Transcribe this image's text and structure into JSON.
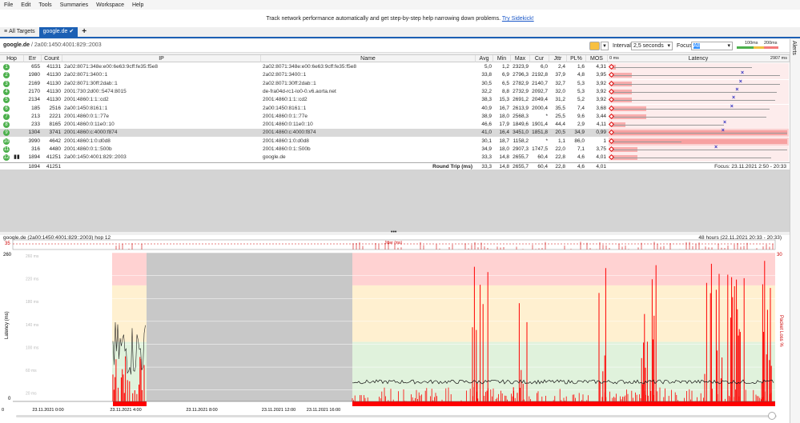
{
  "menu": [
    "File",
    "Edit",
    "Tools",
    "Summaries",
    "Workspace",
    "Help"
  ],
  "banner": {
    "text": "Track network performance automatically and get step-by-step help narrowing down problems.",
    "link": "Try Sidekick!"
  },
  "tabs": [
    {
      "label": "All Targets"
    },
    {
      "label": "google.de"
    }
  ],
  "toolbar": {
    "target": "google.de",
    "ip": "/ 2a00:1450:4001:829::2003",
    "interval_label": "Interval",
    "interval_value": "2,5 seconds",
    "focus_label": "Focus",
    "focus_value": "All",
    "scale_100": "100ms",
    "scale_200": "200ms"
  },
  "side_label": "Alerts",
  "columns": {
    "hop": "Hop",
    "err": "Err",
    "count": "Count",
    "ip": "IP",
    "name": "Name",
    "avg": "Avg",
    "min": "Min",
    "max": "Max",
    "cur": "Cur",
    "jttr": "Jttr",
    "pl": "PL%",
    "mos": "MOS",
    "latency": "Latency",
    "lat_min": "0 ms",
    "lat_max": "2907 ms"
  },
  "rows": [
    {
      "hop": "1",
      "err": "655",
      "count": "41131",
      "ip": "2a02:8071:348e:e00:6e63:9cff:fe35:f5e8",
      "name": "2a02:8071:348e:e00:6e63:9cff:fe35:f5e8",
      "avg": "5,0",
      "min": "1,2",
      "max": "2323,9",
      "cur": "6,0",
      "jttr": "2,4",
      "pl": "1,6",
      "mos": "4,31",
      "bar": 0.02,
      "range": 0.8,
      "cross": 0
    },
    {
      "hop": "2",
      "err": "1980",
      "count": "41130",
      "ip": "2a02:8071:3400::1",
      "name": "2a02:8071:3400::1",
      "avg": "33,8",
      "min": "6,9",
      "max": "2796,3",
      "cur": "2192,8",
      "jttr": "37,9",
      "pl": "4,8",
      "mos": "3,95",
      "bar": 0.12,
      "range": 0.96,
      "cross": 0.75
    },
    {
      "hop": "3",
      "err": "2169",
      "count": "41130",
      "ip": "2a02:8071:30ff:2dab::1",
      "name": "2a02:8071:30ff:2dab::1",
      "avg": "30,5",
      "min": "6,5",
      "max": "2782,9",
      "cur": "2140,7",
      "jttr": "32,7",
      "pl": "5,3",
      "mos": "3,92",
      "bar": 0.12,
      "range": 0.96,
      "cross": 0.74
    },
    {
      "hop": "4",
      "err": "2170",
      "count": "41130",
      "ip": "2001:730:2d00::5474:8015",
      "name": "de-fra04d-rc1-lo0-0.v6.aorta.net",
      "avg": "32,2",
      "min": "8,8",
      "max": "2732,9",
      "cur": "2092,7",
      "jttr": "32,0",
      "pl": "5,3",
      "mos": "3,92",
      "bar": 0.12,
      "range": 0.94,
      "cross": 0.72
    },
    {
      "hop": "5",
      "err": "2134",
      "count": "41130",
      "ip": "2001:4860:1:1::cd2",
      "name": "2001:4860:1:1::cd2",
      "avg": "38,3",
      "min": "15,3",
      "max": "2691,2",
      "cur": "2049,4",
      "jttr": "31,2",
      "pl": "5,2",
      "mos": "3,92",
      "bar": 0.12,
      "range": 0.93,
      "cross": 0.7
    },
    {
      "hop": "6",
      "err": "185",
      "count": "2516",
      "ip": "2a00:1450:8161::1",
      "name": "2a00:1450:8161::1",
      "avg": "40,9",
      "min": "16,7",
      "max": "2613,9",
      "cur": "2000,4",
      "jttr": "35,5",
      "pl": "7,4",
      "mos": "3,68",
      "bar": 0.2,
      "range": 0.9,
      "cross": 0.69
    },
    {
      "hop": "7",
      "err": "213",
      "count": "2221",
      "ip": "2001:4860:0:1::77e",
      "name": "2001:4860:0:1::77e",
      "avg": "38,9",
      "min": "18,0",
      "max": "2568,3",
      "cur": "*",
      "jttr": "25,5",
      "pl": "9,6",
      "mos": "3,44",
      "bar": 0.2,
      "range": 0.88,
      "cross": 0
    },
    {
      "hop": "8",
      "err": "233",
      "count": "8165",
      "ip": "2001:4860:0:11e0::10",
      "name": "2001:4860:0:11e0::10",
      "avg": "46,6",
      "min": "17,9",
      "max": "1849,6",
      "cur": "1901,4",
      "jttr": "44,4",
      "pl": "2,9",
      "mos": "4,11",
      "bar": 0.08,
      "range": 0.64,
      "cross": 0.65
    },
    {
      "hop": "9",
      "err": "1304",
      "count": "3741",
      "ip": "2001:4860:c:4000:f874",
      "name": "2001:4860:c:4000:f874",
      "avg": "41,0",
      "min": "16,4",
      "max": "3451,0",
      "cur": "1851,8",
      "jttr": "20,5",
      "pl": "34,9",
      "mos": "0,99",
      "bar": 1.0,
      "range": 1.0,
      "cross": 0.64
    },
    {
      "hop": "10",
      "err": "3990",
      "count": "4642",
      "ip": "2001:4860:1:0:d0d8",
      "name": "2001:4860:1:0:d0d8",
      "avg": "30,1",
      "min": "18,7",
      "max": "1158,2",
      "cur": "*",
      "jttr": "1,1",
      "pl": "86,0",
      "mos": "1",
      "bar": 1.0,
      "range": 0.4,
      "cross": 0
    },
    {
      "hop": "11",
      "err": "316",
      "count": "4480",
      "ip": "2001:4860:0:1::500b",
      "name": "2001:4860:0:1::500b",
      "avg": "34,9",
      "min": "18,0",
      "max": "2907,3",
      "cur": "1747,5",
      "jttr": "22,0",
      "pl": "7,1",
      "mos": "3,75",
      "bar": 0.15,
      "range": 1.0,
      "cross": 0.6
    },
    {
      "hop": "12",
      "err": "1894",
      "count": "41251",
      "ip": "2a00:1450:4001:829::2003",
      "name": "google.de",
      "avg": "33,3",
      "min": "14,8",
      "max": "2655,7",
      "cur": "60,4",
      "jttr": "22,8",
      "pl": "4,6",
      "mos": "4,01",
      "bar": 0.15,
      "range": 0.91,
      "cross": 0
    }
  ],
  "totals": {
    "err": "1894",
    "count": "41251",
    "label": "Round Trip (ms)",
    "avg": "33,3",
    "min": "14,8",
    "max": "2655,7",
    "cur": "60,4",
    "jttr": "22,8",
    "pl": "4,6",
    "mos": "4,01",
    "focus": "Focus: 23.11.2021 2:50 - 20:33"
  },
  "graph": {
    "title": "google.de (2a00:1450:4001:829::2003) hop 12",
    "range": "48 hours (22.11.2021 20:33 - 20:33)",
    "y_top": "260",
    "y_bottom": "0",
    "y_axis_label": "Latency (ms)",
    "right_top": "30",
    "right_label": "Packet Loss %",
    "jitter_label": "Jitter (ms)",
    "jitter_scale": "35",
    "x_zero": "0",
    "x_ticks": [
      "23.11.2021 0:00",
      "23.11.2021 4:00",
      "23.11.2021 8:00",
      "23.11.2021 12:00",
      "23.11.2021 16:00"
    ],
    "y_gridlines": [
      "260 ms",
      "220 ms",
      "180 ms",
      "140 ms",
      "100 ms",
      "60 ms",
      "20 ms"
    ]
  },
  "colors": {
    "accent": "#1c60b4",
    "hop_ok": "#4cb04c",
    "bar_red": "#f47a7a",
    "loss_red": "#ff0000",
    "zone_red": "#ffd2d2",
    "zone_yellow": "#fff0d0",
    "zone_green": "#e0f2dc",
    "gray": "#c8c8c8"
  }
}
